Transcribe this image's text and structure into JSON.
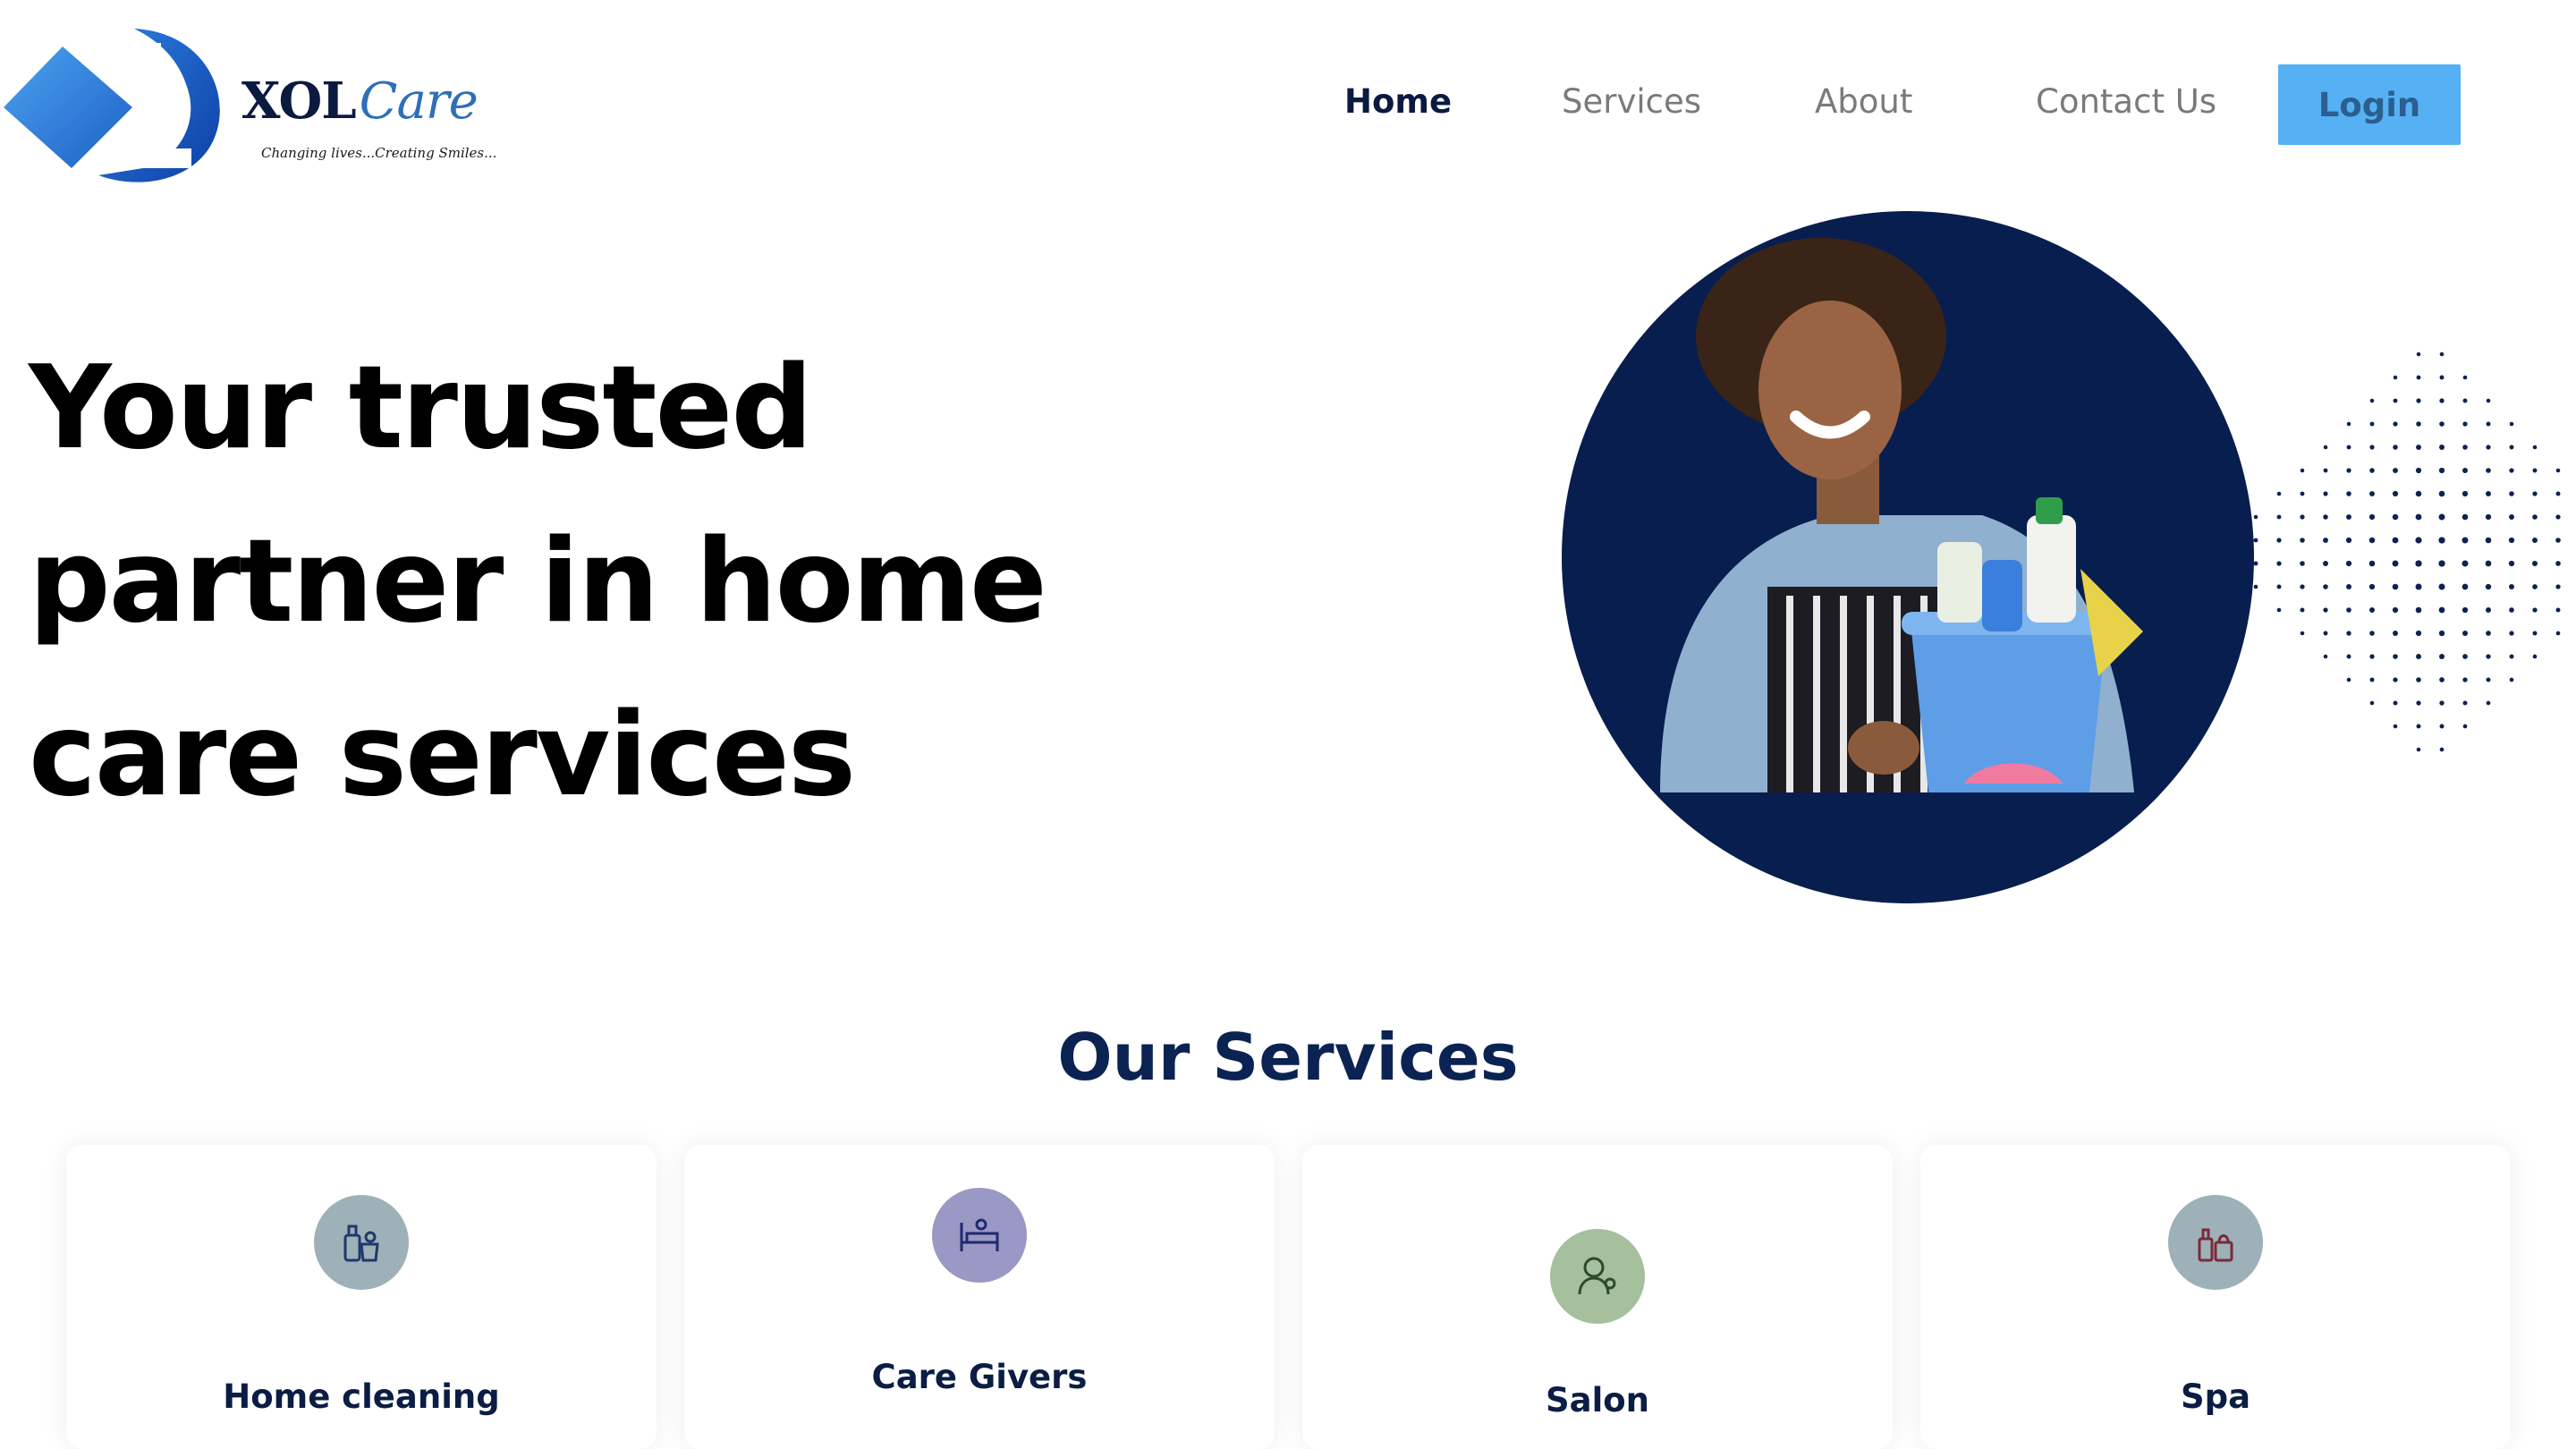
{
  "header": {
    "brand_main": "XOL",
    "brand_accent": "Care",
    "tagline": "Changing lives...Creating Smiles..."
  },
  "nav": {
    "home": "Home",
    "services": "Services",
    "about": "About",
    "contact": "Contact Us",
    "login": "Login"
  },
  "hero": {
    "title_line1": "Your trusted",
    "title_line2": "partner in home",
    "title_line3": "care services"
  },
  "services": {
    "heading": "Our Services",
    "items": [
      {
        "label": "Home cleaning",
        "icon": "cleaning-supplies-icon",
        "color": "#9eb0b8"
      },
      {
        "label": "Care Givers",
        "icon": "hospital-bed-icon",
        "color": "#9a98c4"
      },
      {
        "label": "Salon",
        "icon": "hairdresser-icon",
        "color": "#a6bf9c"
      },
      {
        "label": "Spa",
        "icon": "spa-products-icon",
        "color": "#9eb0b8"
      }
    ]
  },
  "colors": {
    "accent": "#55b1f3",
    "navy": "#071e4e",
    "text_dark": "#0b1d44"
  }
}
